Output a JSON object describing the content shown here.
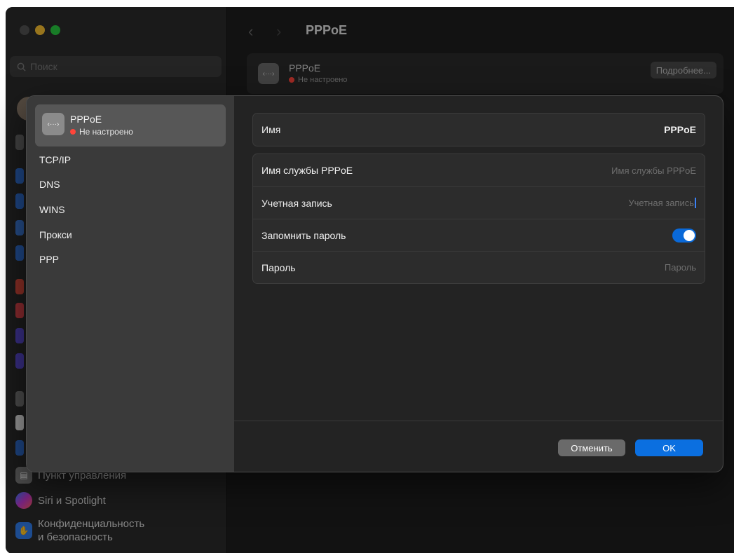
{
  "window": {
    "title": "PPPoE"
  },
  "sidebar": {
    "search_placeholder": "Поиск",
    "items": [
      {
        "label": "Пункт управления",
        "icon": "control-center-icon",
        "color": "#7d7d7d"
      },
      {
        "label": "Siri и Spotlight",
        "icon": "siri-icon",
        "color": "#b03ab7"
      },
      {
        "label_line1": "Конфиденциальность",
        "label_line2": "и безопасность",
        "icon": "hand-icon",
        "color": "#2f7be8"
      }
    ]
  },
  "background_card": {
    "name": "PPPoE",
    "status": "Не настроено",
    "more_button": "Подробнее..."
  },
  "sheet": {
    "service": {
      "name": "PPPoE",
      "status": "Не настроено"
    },
    "tabs": [
      "TCP/IP",
      "DNS",
      "WINS",
      "Прокси",
      "PPP"
    ],
    "name_row": {
      "label": "Имя",
      "value": "PPPoE"
    },
    "fields": {
      "service_name_label": "Имя службы PPPoE",
      "service_name_placeholder": "Имя службы PPPoE",
      "account_label": "Учетная запись",
      "account_placeholder": "Учетная запись",
      "remember_label": "Запомнить пароль",
      "remember_on": true,
      "password_label": "Пароль",
      "password_placeholder": "Пароль"
    },
    "buttons": {
      "cancel": "Отменить",
      "ok": "OK"
    }
  },
  "colors": {
    "accent": "#0b6fe0",
    "status_red": "#ff453a"
  }
}
